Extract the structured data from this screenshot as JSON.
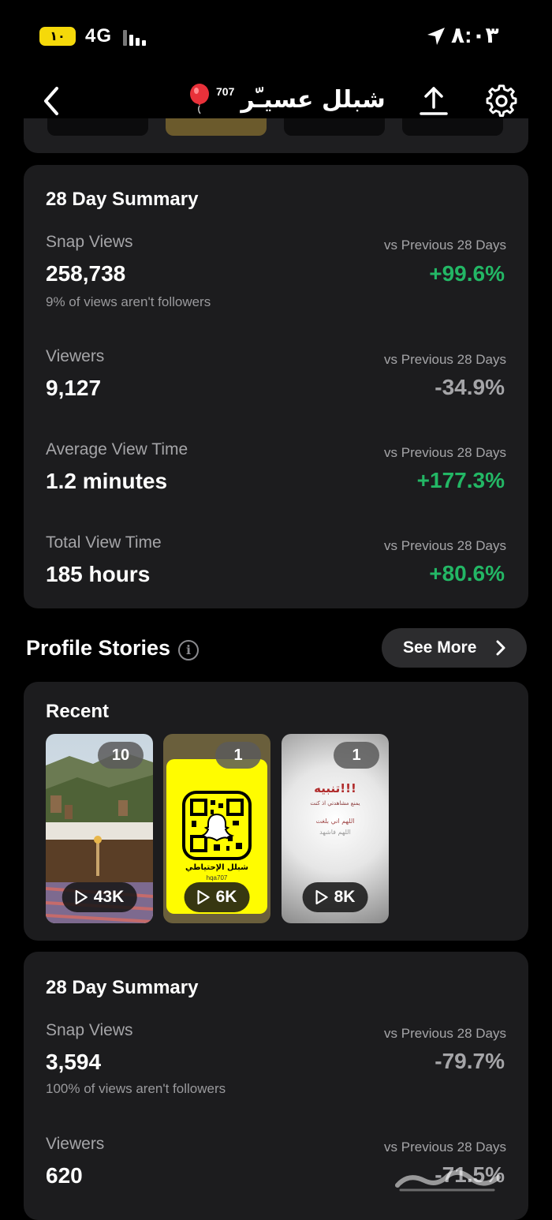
{
  "status_bar": {
    "battery": "١٠",
    "battery_level": 0.1,
    "network": "4G",
    "time": "٨:٠٣"
  },
  "header": {
    "title": "شبلل عسيـّر",
    "badge": "707",
    "icons": [
      "back-chevron-icon",
      "balloon-icon",
      "share-icon",
      "gear-icon"
    ]
  },
  "summary1": {
    "title": "28 Day Summary",
    "metrics": [
      {
        "label": "Snap Views",
        "value": "258,738",
        "note": "9% of views aren't followers",
        "vs": "vs Previous 28 Days",
        "change": "+99.6%"
      },
      {
        "label": "Viewers",
        "value": "9,127",
        "vs": "vs Previous 28 Days",
        "change": "-34.9%"
      },
      {
        "label": "Average View Time",
        "value": "1.2 minutes",
        "vs": "vs Previous 28 Days",
        "change": "+177.3%"
      },
      {
        "label": "Total View Time",
        "value": "185 hours",
        "vs": "vs Previous 28 Days",
        "change": "+80.6%"
      }
    ]
  },
  "profile_stories": {
    "title": "Profile Stories",
    "see_more": "See More",
    "recent_title": "Recent",
    "stories": [
      {
        "count": "10",
        "views": "43K"
      },
      {
        "count": "1",
        "views": "6K",
        "caption": "شبلل الإحتياطي",
        "handle": "hqa707"
      },
      {
        "count": "1",
        "views": "8K",
        "heading": "تنبيه!!!",
        "line1": "يمنع مشاهدتي اذ كنت",
        "line2": "اللهم اني بلغت",
        "line3": "اللهم فاشهد"
      }
    ]
  },
  "summary2": {
    "title": "28 Day Summary",
    "metrics": [
      {
        "label": "Snap Views",
        "value": "3,594",
        "note": "100% of views aren't followers",
        "vs": "vs Previous 28 Days",
        "change": "-79.7%"
      },
      {
        "label": "Viewers",
        "value": "620",
        "vs": "vs Previous 28 Days",
        "change": "-71.5%"
      }
    ]
  },
  "colors": {
    "positive": "#23b765",
    "neutral": "#a5a5a8",
    "card": "#1c1c1e",
    "background": "#000000"
  }
}
